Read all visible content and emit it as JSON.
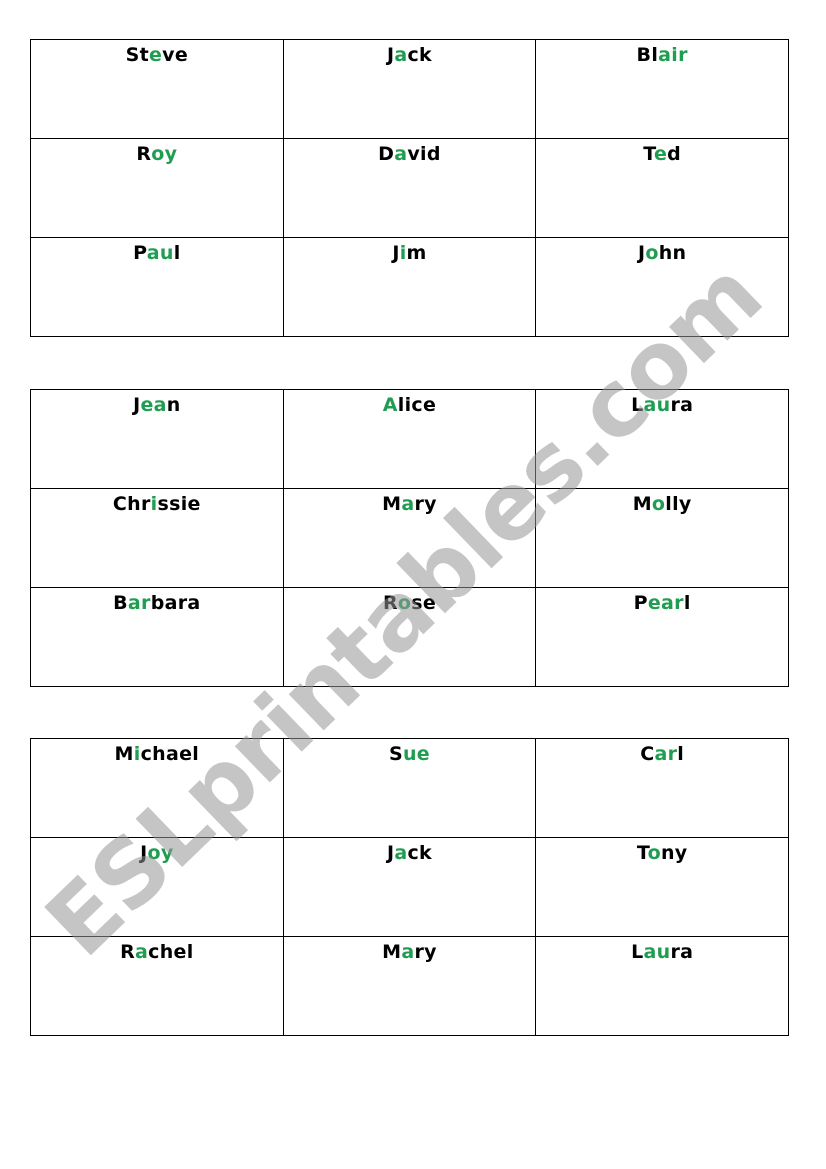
{
  "watermark": "ESLprintables.com",
  "colors": {
    "highlight": "#1f9d50",
    "text": "#000000",
    "watermark": "#969696"
  },
  "tables": [
    {
      "rows": [
        [
          {
            "name": "Steve",
            "segments": [
              {
                "t": "St",
                "hl": false
              },
              {
                "t": "e",
                "hl": true
              },
              {
                "t": "ve",
                "hl": false
              }
            ]
          },
          {
            "name": "Jack",
            "segments": [
              {
                "t": "J",
                "hl": false
              },
              {
                "t": "a",
                "hl": true
              },
              {
                "t": "ck",
                "hl": false
              }
            ]
          },
          {
            "name": "Blair",
            "segments": [
              {
                "t": "Bl",
                "hl": false
              },
              {
                "t": "air",
                "hl": true
              }
            ]
          }
        ],
        [
          {
            "name": "Roy",
            "segments": [
              {
                "t": "R",
                "hl": false
              },
              {
                "t": "oy",
                "hl": true
              }
            ]
          },
          {
            "name": "David",
            "segments": [
              {
                "t": "D",
                "hl": false
              },
              {
                "t": "a",
                "hl": true
              },
              {
                "t": "vid",
                "hl": false
              }
            ]
          },
          {
            "name": "Ted",
            "segments": [
              {
                "t": "T",
                "hl": false
              },
              {
                "t": "e",
                "hl": true
              },
              {
                "t": "d",
                "hl": false
              }
            ]
          }
        ],
        [
          {
            "name": "Paul",
            "segments": [
              {
                "t": "P",
                "hl": false
              },
              {
                "t": "au",
                "hl": true
              },
              {
                "t": "l",
                "hl": false
              }
            ]
          },
          {
            "name": "Jim",
            "segments": [
              {
                "t": "J",
                "hl": false
              },
              {
                "t": "i",
                "hl": true
              },
              {
                "t": "m",
                "hl": false
              }
            ]
          },
          {
            "name": "John",
            "segments": [
              {
                "t": "J",
                "hl": false
              },
              {
                "t": "o",
                "hl": true
              },
              {
                "t": "hn",
                "hl": false
              }
            ]
          }
        ]
      ]
    },
    {
      "rows": [
        [
          {
            "name": "Jean",
            "segments": [
              {
                "t": "J",
                "hl": false
              },
              {
                "t": "ea",
                "hl": true
              },
              {
                "t": "n",
                "hl": false
              }
            ]
          },
          {
            "name": "Alice",
            "segments": [
              {
                "t": "A",
                "hl": true
              },
              {
                "t": "lice",
                "hl": false
              }
            ]
          },
          {
            "name": "Laura",
            "segments": [
              {
                "t": "L",
                "hl": false
              },
              {
                "t": "au",
                "hl": true
              },
              {
                "t": "ra",
                "hl": false
              }
            ]
          }
        ],
        [
          {
            "name": "Chrissie",
            "segments": [
              {
                "t": "Chr",
                "hl": false
              },
              {
                "t": "i",
                "hl": true
              },
              {
                "t": "ssie",
                "hl": false
              }
            ]
          },
          {
            "name": "Mary",
            "segments": [
              {
                "t": "M",
                "hl": false
              },
              {
                "t": "a",
                "hl": true
              },
              {
                "t": "ry",
                "hl": false
              }
            ]
          },
          {
            "name": "Molly",
            "segments": [
              {
                "t": "M",
                "hl": false
              },
              {
                "t": "o",
                "hl": true
              },
              {
                "t": "lly",
                "hl": false
              }
            ]
          }
        ],
        [
          {
            "name": "Barbara",
            "segments": [
              {
                "t": "B",
                "hl": false
              },
              {
                "t": "ar",
                "hl": true
              },
              {
                "t": "bara",
                "hl": false
              }
            ]
          },
          {
            "name": "Rose",
            "segments": [
              {
                "t": "R",
                "hl": false
              },
              {
                "t": "o",
                "hl": true
              },
              {
                "t": "se",
                "hl": false
              }
            ]
          },
          {
            "name": "Pearl",
            "segments": [
              {
                "t": "P",
                "hl": false
              },
              {
                "t": "ear",
                "hl": true
              },
              {
                "t": "l",
                "hl": false
              }
            ]
          }
        ]
      ]
    },
    {
      "rows": [
        [
          {
            "name": "Michael",
            "segments": [
              {
                "t": "M",
                "hl": false
              },
              {
                "t": "i",
                "hl": true
              },
              {
                "t": "chael",
                "hl": false
              }
            ]
          },
          {
            "name": "Sue",
            "segments": [
              {
                "t": "S",
                "hl": false
              },
              {
                "t": "ue",
                "hl": true
              }
            ]
          },
          {
            "name": "Carl",
            "segments": [
              {
                "t": "C",
                "hl": false
              },
              {
                "t": "ar",
                "hl": true
              },
              {
                "t": "l",
                "hl": false
              }
            ]
          }
        ],
        [
          {
            "name": "Joy",
            "segments": [
              {
                "t": "J",
                "hl": false
              },
              {
                "t": "oy",
                "hl": true
              }
            ]
          },
          {
            "name": "Jack",
            "segments": [
              {
                "t": "J",
                "hl": false
              },
              {
                "t": "a",
                "hl": true
              },
              {
                "t": "ck",
                "hl": false
              }
            ]
          },
          {
            "name": "Tony",
            "segments": [
              {
                "t": "T",
                "hl": false
              },
              {
                "t": "o",
                "hl": true
              },
              {
                "t": "ny",
                "hl": false
              }
            ]
          }
        ],
        [
          {
            "name": "Rachel",
            "segments": [
              {
                "t": "R",
                "hl": false
              },
              {
                "t": "a",
                "hl": true
              },
              {
                "t": "chel",
                "hl": false
              }
            ]
          },
          {
            "name": "Mary",
            "segments": [
              {
                "t": "M",
                "hl": false
              },
              {
                "t": "a",
                "hl": true
              },
              {
                "t": "ry",
                "hl": false
              }
            ]
          },
          {
            "name": "Laura",
            "segments": [
              {
                "t": "L",
                "hl": false
              },
              {
                "t": "au",
                "hl": true
              },
              {
                "t": "ra",
                "hl": false
              }
            ]
          }
        ]
      ]
    }
  ]
}
